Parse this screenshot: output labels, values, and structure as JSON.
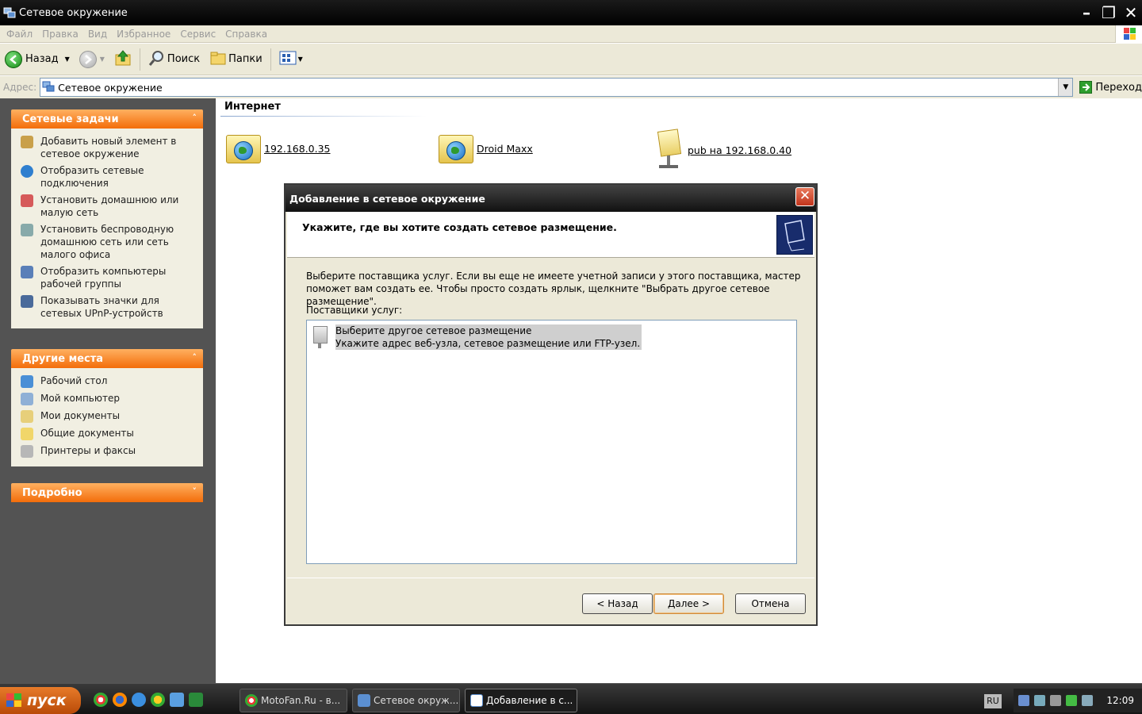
{
  "window": {
    "title": "Сетевое окружение"
  },
  "menu": [
    "Файл",
    "Правка",
    "Вид",
    "Избранное",
    "Сервис",
    "Справка"
  ],
  "toolbar": {
    "back": "Назад",
    "search": "Поиск",
    "folders": "Папки"
  },
  "address": {
    "label": "Адрес:",
    "value": "Сетевое окружение",
    "go": "Переход"
  },
  "left_panel": {
    "network_tasks": {
      "title": "Сетевые задачи",
      "items": [
        "Добавить новый элемент в сетевое окружение",
        "Отобразить сетевые подключения",
        "Установить домашнюю или малую сеть",
        "Установить беспроводную домашнюю сеть или сеть малого офиса",
        "Отобразить компьютеры рабочей группы",
        "Показывать значки для сетевых UPnP-устройств"
      ]
    },
    "other_places": {
      "title": "Другие места",
      "items": [
        "Рабочий стол",
        "Мой компьютер",
        "Мои документы",
        "Общие документы",
        "Принтеры и факсы"
      ]
    },
    "details": {
      "title": "Подробно"
    }
  },
  "content": {
    "group": "Интернет",
    "items": [
      "192.168.0.35",
      "Droid Maxx",
      "pub на 192.168.0.40"
    ]
  },
  "dialog": {
    "title": "Добавление в сетевое окружение",
    "heading": "Укажите, где вы хотите создать сетевое размещение.",
    "description": "Выберите поставщика услуг. Если вы еще не имеете учетной записи у этого поставщика, мастер поможет вам создать ее. Чтобы просто создать ярлык, щелкните \"Выбрать другое сетевое размещение\".",
    "providers_label": "Поставщики услуг:",
    "provider": {
      "title": "Выберите другое сетевое размещение",
      "subtitle": "Укажите адрес веб-узла, сетевое размещение или FTP-узел."
    },
    "buttons": {
      "back": "< Назад",
      "next": "Далее >",
      "cancel": "Отмена"
    }
  },
  "taskbar": {
    "start": "пуск",
    "tasks": [
      "MotoFan.Ru - в...",
      "Сетевое окруж...",
      "Добавление в с..."
    ],
    "lang": "RU",
    "clock": "12:09"
  }
}
